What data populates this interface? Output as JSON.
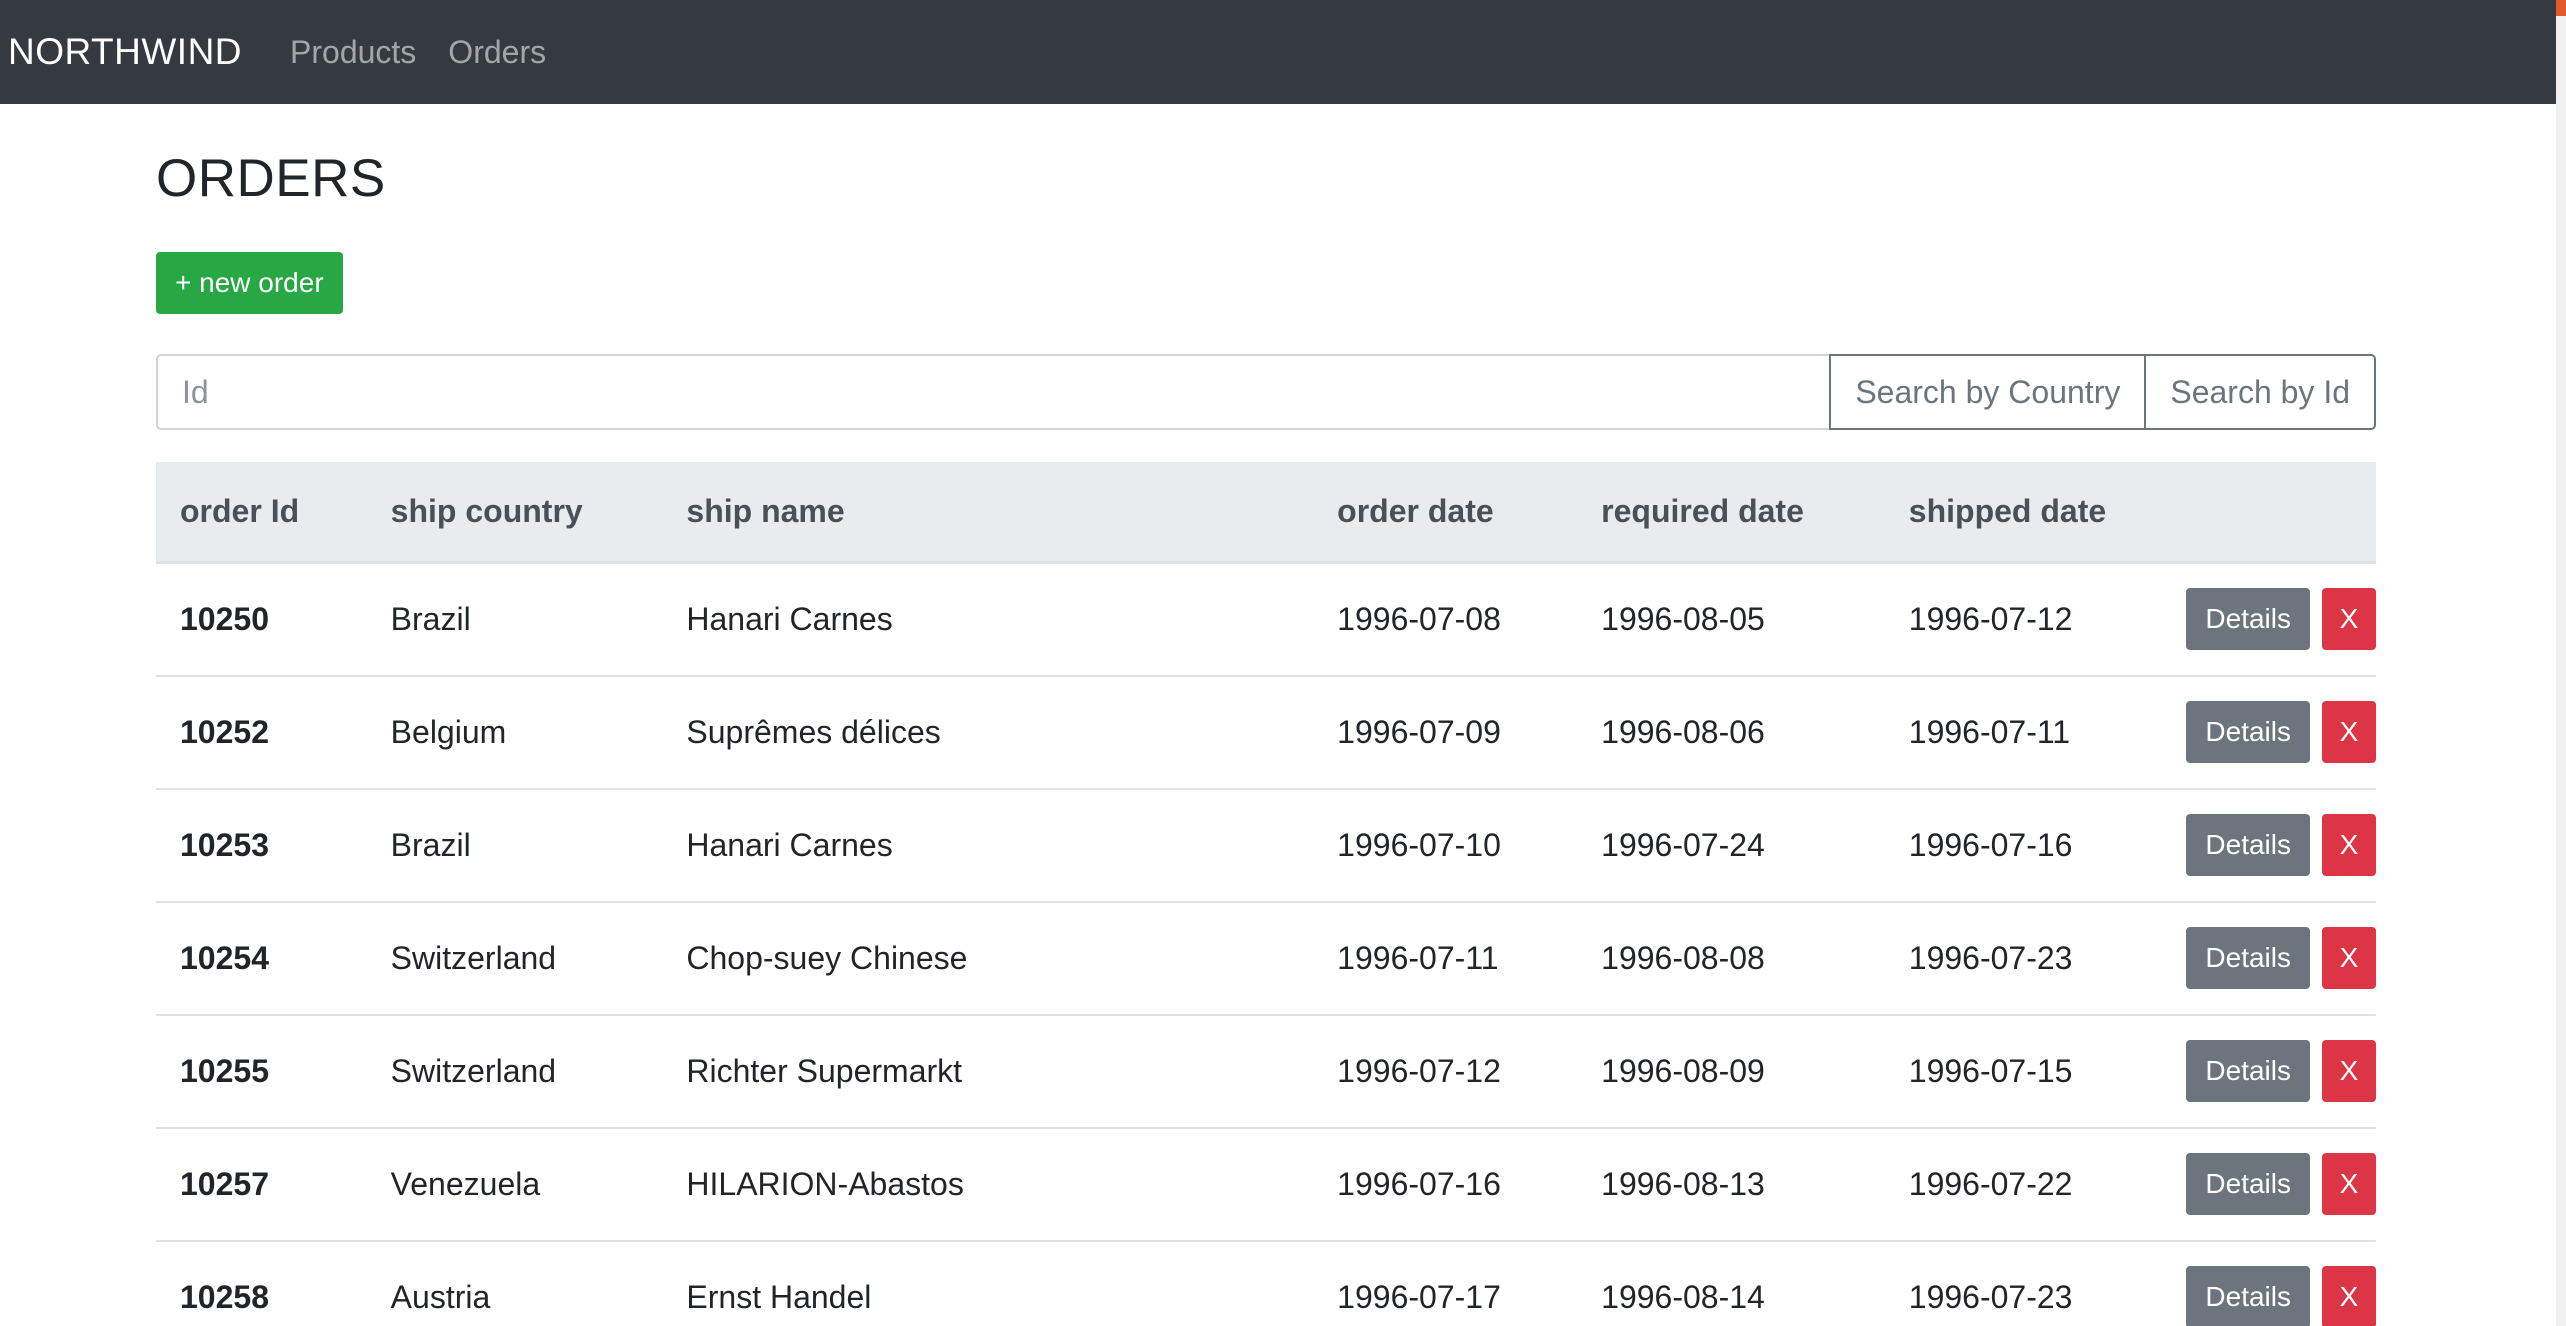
{
  "navbar": {
    "brand": "NORTHWIND",
    "links": [
      "Products",
      "Orders"
    ]
  },
  "page": {
    "title": "ORDERS",
    "new_order_label": "+ new order"
  },
  "search": {
    "placeholder": "Id",
    "value": "",
    "by_country_label": "Search by Country",
    "by_id_label": "Search by Id"
  },
  "table": {
    "headers": [
      "order Id",
      "ship country",
      "ship name",
      "order date",
      "required date",
      "shipped date",
      ""
    ],
    "rows": [
      {
        "id": "10250",
        "country": "Brazil",
        "name": "Hanari Carnes",
        "order_date": "1996-07-08",
        "required_date": "1996-08-05",
        "shipped_date": "1996-07-12"
      },
      {
        "id": "10252",
        "country": "Belgium",
        "name": "Suprêmes délices",
        "order_date": "1996-07-09",
        "required_date": "1996-08-06",
        "shipped_date": "1996-07-11"
      },
      {
        "id": "10253",
        "country": "Brazil",
        "name": "Hanari Carnes",
        "order_date": "1996-07-10",
        "required_date": "1996-07-24",
        "shipped_date": "1996-07-16"
      },
      {
        "id": "10254",
        "country": "Switzerland",
        "name": "Chop-suey Chinese",
        "order_date": "1996-07-11",
        "required_date": "1996-08-08",
        "shipped_date": "1996-07-23"
      },
      {
        "id": "10255",
        "country": "Switzerland",
        "name": "Richter Supermarkt",
        "order_date": "1996-07-12",
        "required_date": "1996-08-09",
        "shipped_date": "1996-07-15"
      },
      {
        "id": "10257",
        "country": "Venezuela",
        "name": "HILARION-Abastos",
        "order_date": "1996-07-16",
        "required_date": "1996-08-13",
        "shipped_date": "1996-07-22"
      },
      {
        "id": "10258",
        "country": "Austria",
        "name": "Ernst Handel",
        "order_date": "1996-07-17",
        "required_date": "1996-08-14",
        "shipped_date": "1996-07-23"
      }
    ],
    "details_label": "Details",
    "delete_label": "X"
  },
  "colors": {
    "navbar_bg": "#343a40",
    "success": "#28a745",
    "secondary": "#6c757d",
    "danger": "#dc3545",
    "table_header_bg": "#e9ecef"
  }
}
